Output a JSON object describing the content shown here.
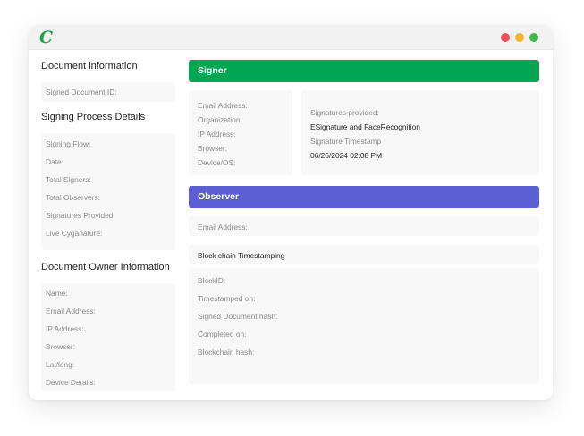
{
  "app": {
    "logo_letter": "C"
  },
  "window_controls": [
    "close",
    "minimize",
    "maximize"
  ],
  "left": {
    "doc_info": {
      "title": "Document information",
      "fields": [
        "Signed Document ID:"
      ]
    },
    "signing": {
      "title": "Signing Process Details",
      "fields": [
        "Signing Flow:",
        "Date:",
        "Total Signers:",
        "Total Observers:",
        "Signatures Provided:",
        "Live Cyganature:"
      ]
    },
    "owner": {
      "title": "Document Owner Information",
      "fields": [
        "Name:",
        "Email Address:",
        "IP Address:",
        "Browser:",
        "Lat/long:",
        "Device Details:"
      ]
    }
  },
  "signer": {
    "title": "Signer",
    "fields": [
      "Email Address:",
      "Organization:",
      "IP Address:",
      "Browser:",
      "Device/OS:"
    ],
    "signatures_label": "Signatures provided:",
    "signatures_value": "ESignature and FaceRecognition",
    "timestamp_label": "Signature Timestamp",
    "timestamp_value": "06/26/2024 02:08 PM"
  },
  "observer": {
    "title": "Observer",
    "email_label": "Email Address:"
  },
  "blockchain": {
    "title": "Block chain Timestamping",
    "fields": [
      "BlockID:",
      "Timestamped on:",
      "Signed Document hash:",
      "Completed on:",
      "Blockchain hash:"
    ]
  },
  "colors": {
    "signer": "#00a651",
    "observer": "#5b5fd1",
    "logo": "#1fa34a"
  }
}
